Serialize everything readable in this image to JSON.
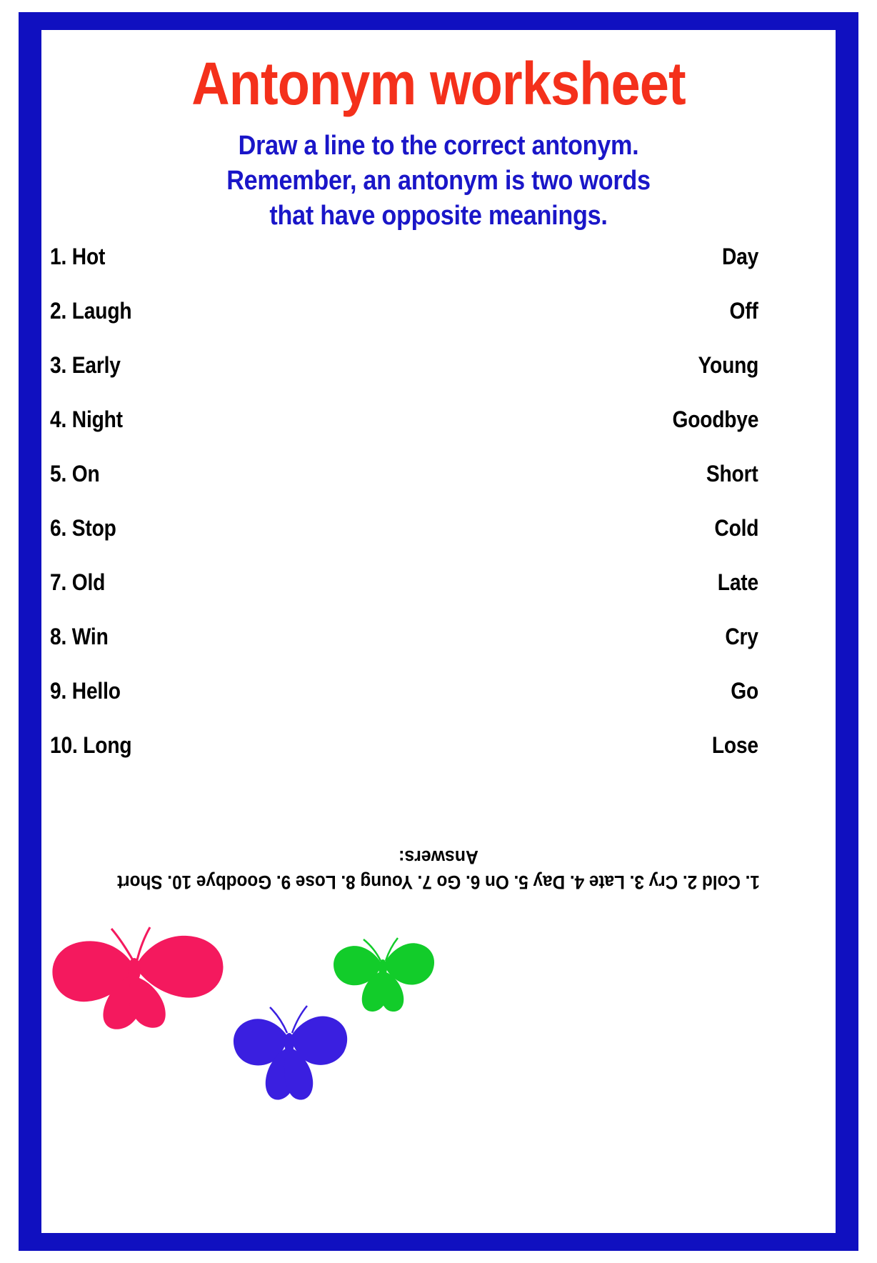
{
  "colors": {
    "border": "#1010c0",
    "page": "#ffffff",
    "title": "#f4301b",
    "subtitle": "#1a16c8",
    "word": "#000000",
    "butterfly_pink": "#f4195e",
    "butterfly_green": "#12cc2a",
    "butterfly_blue": "#3a1fe0"
  },
  "header": {
    "title": "Antonym worksheet",
    "subtitle_lines": [
      "Draw a line to the correct antonym.",
      "Remember, an antonym is two words",
      "that have opposite meanings."
    ]
  },
  "exercise": {
    "rows": [
      {
        "left": "1. Hot",
        "right": "Day"
      },
      {
        "left": "2. Laugh",
        "right": "Off"
      },
      {
        "left": "3. Early",
        "right": "Young"
      },
      {
        "left": "4. Night",
        "right": "Goodbye"
      },
      {
        "left": "5. On",
        "right": "Short"
      },
      {
        "left": "6. Stop",
        "right": "Cold"
      },
      {
        "left": "7. Old",
        "right": "Late"
      },
      {
        "left": "8. Win",
        "right": "Cry"
      },
      {
        "left": "9. Hello",
        "right": "Go"
      },
      {
        "left": "10. Long",
        "right": "Lose"
      }
    ]
  },
  "answers": {
    "label": "Answers:",
    "line": "1. Cold 2. Cry 3. Late 4. Day 5. On 6. Go 7. Young 8. Lose 9. Goodbye 10. Short"
  },
  "decorations": {
    "butterflies": [
      {
        "name": "butterfly-pink",
        "color": "#f4195e"
      },
      {
        "name": "butterfly-green",
        "color": "#12cc2a"
      },
      {
        "name": "butterfly-blue",
        "color": "#3a1fe0"
      }
    ]
  }
}
